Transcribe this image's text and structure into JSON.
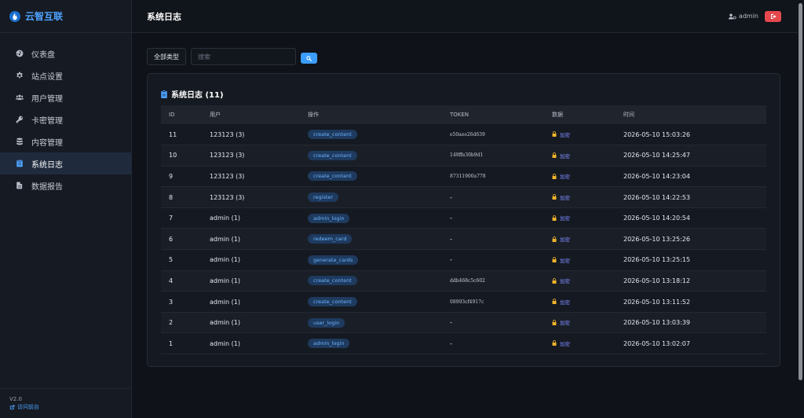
{
  "brand": {
    "name": "云智互联"
  },
  "sidebar": {
    "items": [
      {
        "label": "仪表盘",
        "icon": "dashboard-icon",
        "active": false
      },
      {
        "label": "站点设置",
        "icon": "gear-icon",
        "active": false
      },
      {
        "label": "用户管理",
        "icon": "users-icon",
        "active": false
      },
      {
        "label": "卡密管理",
        "icon": "key-icon",
        "active": false
      },
      {
        "label": "内容管理",
        "icon": "database-icon",
        "active": false
      },
      {
        "label": "系统日志",
        "icon": "clipboard-icon",
        "active": true
      },
      {
        "label": "数据报告",
        "icon": "file-icon",
        "active": false
      }
    ],
    "version": "V2.0",
    "visit_label": "访问前台"
  },
  "header": {
    "title": "系统日志",
    "user": "admin"
  },
  "toolbar": {
    "type_filter": "全部类型",
    "search_placeholder": "搜索"
  },
  "card": {
    "title": "系统日志 (11)"
  },
  "table": {
    "columns": [
      "ID",
      "用户",
      "操作",
      "TOKEN",
      "数据",
      "时间"
    ],
    "rows": [
      {
        "id": "11",
        "user": "123123 (3)",
        "action": "create_content",
        "token": "e50aee26d639",
        "data": "加密",
        "time": "2026-05-10 15:03:26"
      },
      {
        "id": "10",
        "user": "123123 (3)",
        "action": "create_content",
        "token": "149ffe30b9d1",
        "data": "加密",
        "time": "2026-05-10 14:25:47"
      },
      {
        "id": "9",
        "user": "123123 (3)",
        "action": "create_content",
        "token": "87311900a778",
        "data": "加密",
        "time": "2026-05-10 14:23:04"
      },
      {
        "id": "8",
        "user": "123123 (3)",
        "action": "register",
        "token": "-",
        "data": "加密",
        "time": "2026-05-10 14:22:53"
      },
      {
        "id": "7",
        "user": "admin (1)",
        "action": "admin_login",
        "token": "-",
        "data": "加密",
        "time": "2026-05-10 14:20:54"
      },
      {
        "id": "6",
        "user": "admin (1)",
        "action": "redeem_card",
        "token": "-",
        "data": "加密",
        "time": "2026-05-10 13:25:26"
      },
      {
        "id": "5",
        "user": "admin (1)",
        "action": "generate_cards",
        "token": "-",
        "data": "加密",
        "time": "2026-05-10 13:25:15"
      },
      {
        "id": "4",
        "user": "admin (1)",
        "action": "create_content",
        "token": "ddb468c5c602",
        "data": "加密",
        "time": "2026-05-10 13:18:12"
      },
      {
        "id": "3",
        "user": "admin (1)",
        "action": "create_content",
        "token": "08993cf4917c",
        "data": "加密",
        "time": "2026-05-10 13:11:52"
      },
      {
        "id": "2",
        "user": "admin (1)",
        "action": "user_login",
        "token": "-",
        "data": "加密",
        "time": "2026-05-10 13:03:39"
      },
      {
        "id": "1",
        "user": "admin (1)",
        "action": "admin_login",
        "token": "-",
        "data": "加密",
        "time": "2026-05-10 13:02:07"
      }
    ]
  },
  "colors": {
    "accent": "#4da3ff",
    "danger": "#e5484d",
    "background": "#0f1218"
  }
}
